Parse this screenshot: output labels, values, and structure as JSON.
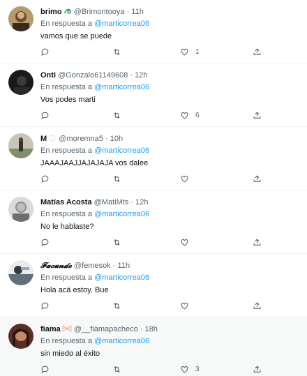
{
  "reply_prefix": "En respuesta a",
  "tweets": [
    {
      "name": "brimo",
      "handle": "@Brimontooya",
      "time": "11h",
      "mention": "@marticorrea06",
      "text": "vamos que se puede",
      "likes": "1",
      "emoji": "green-swirl"
    },
    {
      "name": "Onti",
      "handle": "@Gonzalo61149608",
      "time": "12h",
      "mention": "@marticorrea06",
      "text": "Vos podes marti",
      "likes": "6"
    },
    {
      "name": "M",
      "handle": "@moremna5",
      "time": "10h",
      "mention": "@marticorrea06",
      "text": "JAAAJAAJJAJAJAJA vos dalee",
      "likes": "",
      "emoji": "white-heart"
    },
    {
      "name": "Matías Acosta",
      "handle": "@MatiMts",
      "time": "12h",
      "mention": "@marticorrea06",
      "text": "No le hablaste?",
      "likes": ""
    },
    {
      "name": "𝓕𝓪𝓬𝓾𝓷𝓭𝓸",
      "handle": "@femesok",
      "time": "11h",
      "mention": "@marticorrea06",
      "text": "Hola acá estoy. Bue",
      "likes": ""
    },
    {
      "name": "fiama",
      "handle": "@__fiamapacheco",
      "time": "18h",
      "mention": "@marticorrea06",
      "text": "sin miedo al éxito",
      "likes": "3",
      "emoji": "ribbon"
    }
  ],
  "colors": {
    "accent": "#1d9bf0",
    "muted": "#536471",
    "text": "#0f1419",
    "border": "#eff3f4",
    "highlight": "#f7f9f9"
  }
}
